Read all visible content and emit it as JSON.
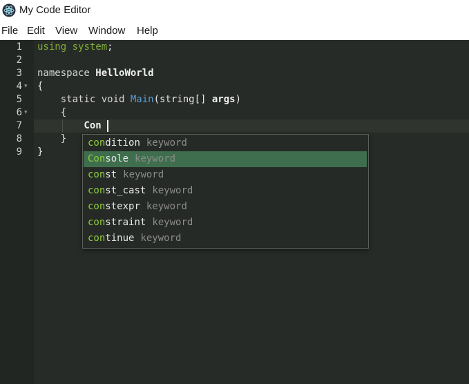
{
  "window": {
    "title": "My Code Editor",
    "icon": "electron-atom-icon"
  },
  "menu": {
    "items": [
      "File",
      "Edit",
      "View",
      "Window",
      "Help"
    ]
  },
  "editor": {
    "line_numbers": [
      "1",
      "2",
      "3",
      "4",
      "5",
      "6",
      "7",
      "8",
      "9"
    ],
    "fold_markers": {
      "4": "▾",
      "6": "▾"
    },
    "lines": [
      [
        {
          "t": "using",
          "c": "green"
        },
        {
          "t": " ",
          "c": "plain"
        },
        {
          "t": "system",
          "c": "green"
        },
        {
          "t": ";",
          "c": "plain"
        }
      ],
      [],
      [
        {
          "t": "namespace",
          "c": "kw"
        },
        {
          "t": " ",
          "c": "plain"
        },
        {
          "t": "HelloWorld",
          "c": "bold"
        }
      ],
      [
        {
          "t": "{",
          "c": "plain"
        }
      ],
      [
        {
          "t": "    static void ",
          "c": "kw"
        },
        {
          "t": "Main",
          "c": "blue"
        },
        {
          "t": "(string[] ",
          "c": "plain"
        },
        {
          "t": "args",
          "c": "bold"
        },
        {
          "t": ")",
          "c": "plain"
        }
      ],
      [
        {
          "t": "    {",
          "c": "plain"
        }
      ],
      [
        {
          "t": "        Con",
          "c": "bold"
        }
      ],
      [
        {
          "t": "    }",
          "c": "plain"
        }
      ],
      [
        {
          "t": "}",
          "c": "plain"
        }
      ]
    ],
    "typed_prefix": "Con"
  },
  "autocomplete": {
    "items": [
      {
        "match": "con",
        "rest": "dition",
        "kind": "keyword",
        "selected": false
      },
      {
        "match": "Con",
        "rest": "sole",
        "kind": "keyword",
        "selected": true
      },
      {
        "match": "con",
        "rest": "st",
        "kind": "keyword",
        "selected": false
      },
      {
        "match": "con",
        "rest": "st_cast",
        "kind": "keyword",
        "selected": false
      },
      {
        "match": "con",
        "rest": "stexpr",
        "kind": "keyword",
        "selected": false
      },
      {
        "match": "con",
        "rest": "straint",
        "kind": "keyword",
        "selected": false
      },
      {
        "match": "con",
        "rest": "tinue",
        "kind": "keyword",
        "selected": false
      }
    ]
  },
  "colors": {
    "editor_bg": "#272b27",
    "gutter_bg": "#222622",
    "selection": "#3e6e4d",
    "match_highlight": "#8fcf3a",
    "keyword_green": "#7fae3a",
    "function_blue": "#5b9bd5"
  }
}
